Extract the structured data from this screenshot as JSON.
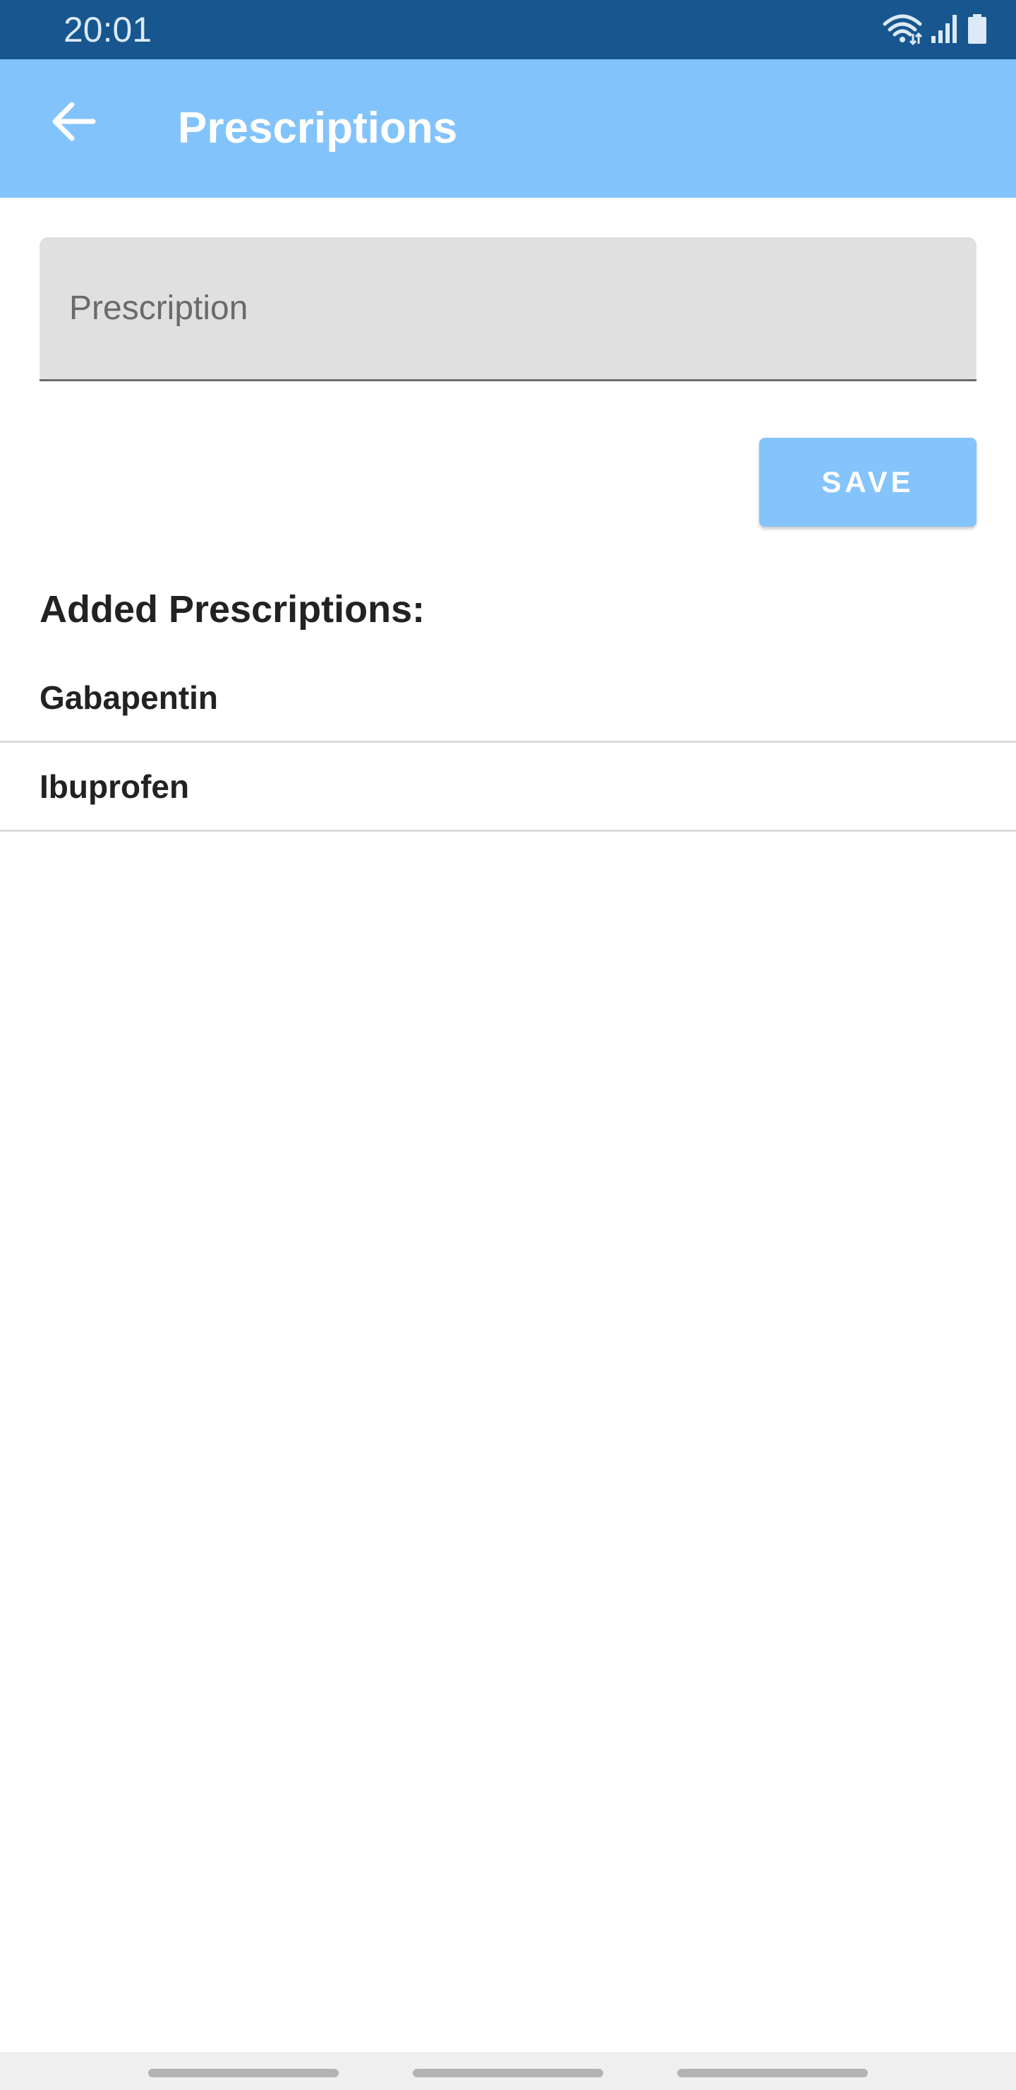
{
  "status_bar": {
    "time": "20:01",
    "icons": [
      "wifi-icon",
      "signal-icon",
      "battery-icon"
    ]
  },
  "app_bar": {
    "title": "Prescriptions",
    "back_icon": "arrow-left-icon",
    "background_color": "#82c3fc"
  },
  "form": {
    "prescription_placeholder": "Prescription",
    "prescription_value": "",
    "save_label": "SAVE"
  },
  "list": {
    "heading": "Added Prescriptions:",
    "items": [
      {
        "label": "Gabapentin"
      },
      {
        "label": "Ibuprofen"
      }
    ]
  },
  "colors": {
    "status_bar": "#17568f",
    "accent": "#84c3fb"
  }
}
